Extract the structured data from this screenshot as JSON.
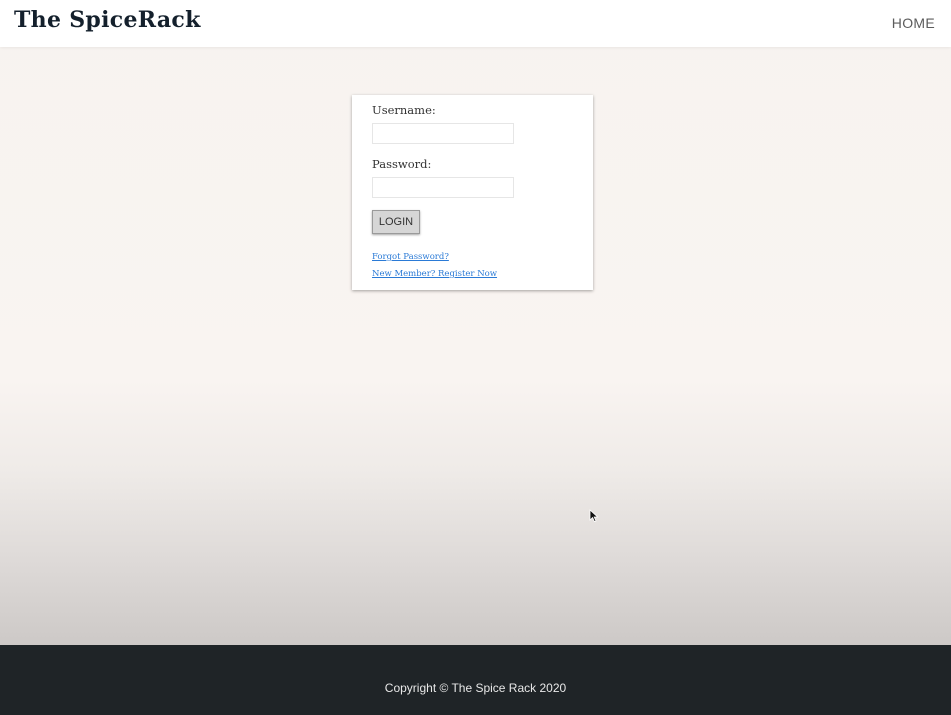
{
  "header": {
    "brand": "The SpiceRack",
    "nav_home": "HOME"
  },
  "login": {
    "username_label": "Username:",
    "username_value": "",
    "password_label": "Password:",
    "password_value": "",
    "login_button": "LOGIN",
    "forgot_link": "Forgot Password?",
    "register_link": "New Member? Register Now"
  },
  "footer": {
    "copyright": "Copyright © The Spice Rack 2020"
  },
  "colors": {
    "brand_text": "#14202c",
    "link": "#2a7ad6",
    "footer_bg": "#1f2427"
  },
  "icons": {
    "cursor": "mouse-pointer-icon"
  }
}
